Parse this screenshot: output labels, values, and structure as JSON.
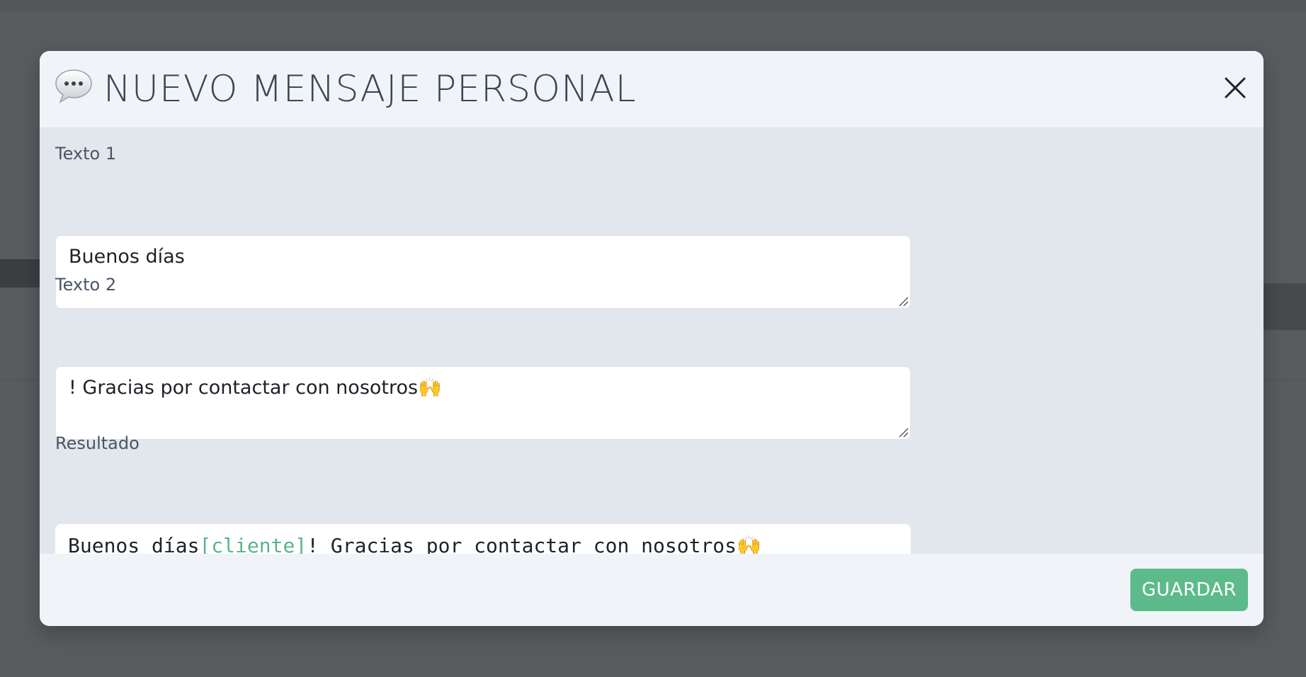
{
  "background": {
    "overlay_color": "#595b5f"
  },
  "modal": {
    "icon": "speech-bubble-icon",
    "title": "NUEVO MENSAJE PERSONAL",
    "close_icon": "close-icon"
  },
  "form": {
    "texto1": {
      "label": "Texto 1",
      "value": "Buenos días"
    },
    "texto2": {
      "label": "Texto 2",
      "value": "! Gracias por contactar con nosotros",
      "value_emoji": "🙌"
    },
    "resultado": {
      "label": "Resultado",
      "part1": "Buenos días",
      "token": "[cliente]",
      "part2": "! Gracias por contactar con nosotros",
      "emoji": "🙌"
    }
  },
  "footer": {
    "save_label": "GUARDAR"
  },
  "colors": {
    "accent_green": "#5dbb8b",
    "title_color": "#3b4656",
    "header_bg": "#f0f4f9",
    "body_bg": "#e2e7ee"
  }
}
